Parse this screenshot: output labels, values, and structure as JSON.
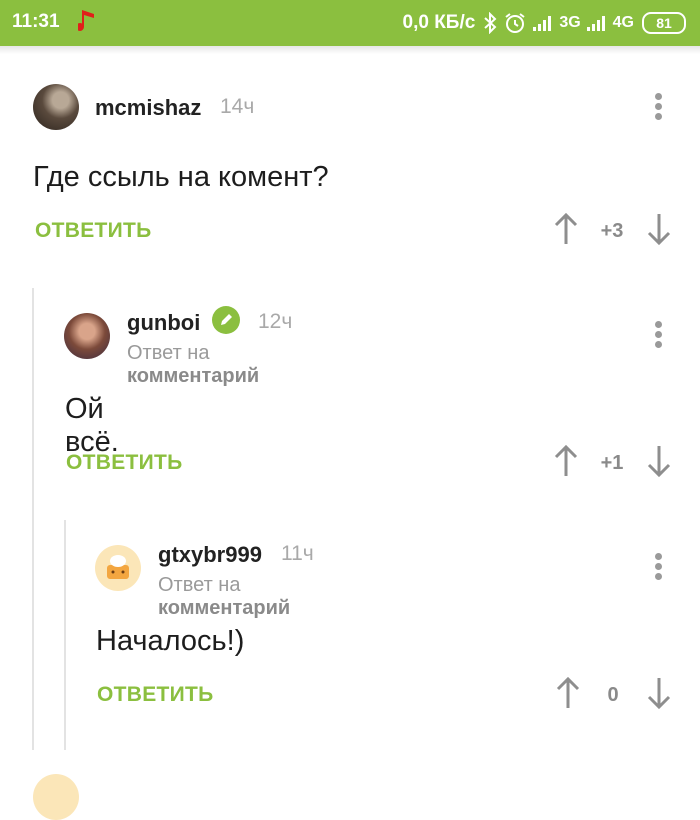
{
  "status_bar": {
    "time": "11:31",
    "speed": "0,0 КБ/с",
    "net1": "3G",
    "net2": "4G",
    "battery": "81",
    "music_icon": "music-note-icon",
    "accent": "#8bbf3f",
    "music_color": "#e0201a"
  },
  "comments": [
    {
      "author": "mcmishaz",
      "time": "14ч",
      "text": "Где ссыль на комент?",
      "reply_label": "ОТВЕТИТЬ",
      "score": "+3"
    },
    {
      "author": "gunboi",
      "time": "12ч",
      "reply_prefix": "Ответ на",
      "reply_target": "комментарий",
      "text": "Ой всё.",
      "reply_label": "ОТВЕТИТЬ",
      "score": "+1"
    },
    {
      "author": "gtxybr999",
      "time": "11ч",
      "reply_prefix": "Ответ на",
      "reply_target": "комментарий",
      "text": "Началось!)",
      "reply_label": "ОТВЕТИТЬ",
      "score": "0"
    }
  ]
}
